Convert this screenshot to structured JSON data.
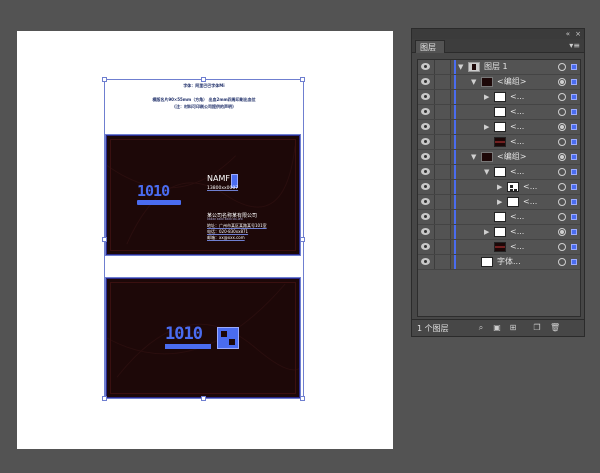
{
  "canvas": {
    "notes": {
      "line1": "字体：阿里巴巴字体Mi",
      "line2": "横版名片90×55mm（方角） 出血2mm四周印刷出血位",
      "line3": "(注：材料可印刷公司提供的声明)"
    },
    "front_card": {
      "logo_text": "1010",
      "name": "NAMF",
      "phone": "13800xx0007",
      "company": "某公司名称某有限公司",
      "company_en": "XXXXX XXXX XXXX CO.,LTD",
      "address": "地址：广州市某区某路某号101室",
      "tel": "电话：020-830xx871",
      "email": "邮箱：xx@xxx.com"
    },
    "back_card": {
      "logo_text": "1010"
    }
  },
  "layers_panel": {
    "collapse_icon": "«",
    "close_icon": "×",
    "tab_label": "图层",
    "menu_icon": "panel-menu-icon",
    "rows": [
      {
        "label": "图层 1",
        "level": 0,
        "expand": "▼",
        "thumb": "layer",
        "target": "ring",
        "selected": true
      },
      {
        "label": "<编组>",
        "level": 1,
        "expand": "▼",
        "thumb": "dark",
        "target": "filled",
        "selected": true
      },
      {
        "label": "<...",
        "level": 2,
        "expand": "▶",
        "thumb": "white",
        "target": "ring",
        "selected": true
      },
      {
        "label": "<...",
        "level": 2,
        "expand": "",
        "thumb": "white",
        "target": "ring",
        "selected": true
      },
      {
        "label": "<...",
        "level": 2,
        "expand": "▶",
        "thumb": "white",
        "target": "filled",
        "selected": true
      },
      {
        "label": "<...",
        "level": 2,
        "expand": "",
        "thumb": "darkline",
        "target": "ring",
        "selected": true
      },
      {
        "label": "<编组>",
        "level": 1,
        "expand": "▼",
        "thumb": "dark",
        "target": "filled",
        "selected": true
      },
      {
        "label": "<...",
        "level": 2,
        "expand": "▼",
        "thumb": "white",
        "target": "ring",
        "selected": true
      },
      {
        "label": "<...",
        "level": 3,
        "expand": "▶",
        "thumb": "qr",
        "target": "ring",
        "selected": true
      },
      {
        "label": "<...",
        "level": 3,
        "expand": "▶",
        "thumb": "white",
        "target": "ring",
        "selected": true
      },
      {
        "label": "<...",
        "level": 2,
        "expand": "",
        "thumb": "white",
        "target": "ring",
        "selected": true
      },
      {
        "label": "<...",
        "level": 2,
        "expand": "▶",
        "thumb": "white",
        "target": "filled",
        "selected": true
      },
      {
        "label": "<...",
        "level": 2,
        "expand": "",
        "thumb": "darkline",
        "target": "ring",
        "selected": true
      },
      {
        "label": "字体...",
        "level": 1,
        "expand": "",
        "thumb": "white",
        "target": "ring",
        "selected": true
      }
    ],
    "footer": {
      "layer_count": "1 个图层"
    }
  }
}
